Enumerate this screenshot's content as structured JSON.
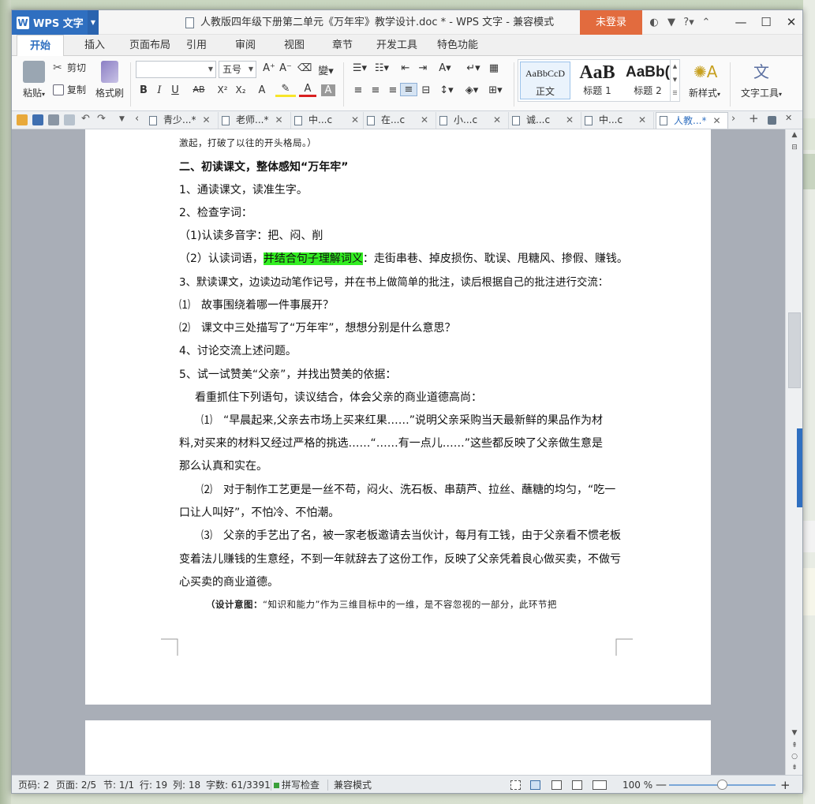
{
  "window": {
    "app_button": "WPS 文字",
    "title": "人教版四年级下册第二单元《万年牢》教学设计.doc * - WPS 文字 - 兼容模式",
    "login": "未登录",
    "title_icons": [
      "skin-icon",
      "shirt-icon",
      "help-icon",
      "ribbon-toggle-icon"
    ],
    "help": "?"
  },
  "ribbon_tabs": [
    "开始",
    "插入",
    "页面布局",
    "引用",
    "审阅",
    "视图",
    "章节",
    "开发工具",
    "特色功能"
  ],
  "ribbon": {
    "paste": "粘贴",
    "cut": "剪切",
    "copy": "复制",
    "format_painter": "格式刷",
    "font_name": "",
    "font_size": "五号",
    "grow_font": "A⁺",
    "shrink_font": "A⁻",
    "bold": "B",
    "italic": "I",
    "underline": "U",
    "strike": "AB",
    "superscript": "X²",
    "subscript": "X₂",
    "styles": [
      {
        "preview": "AaBbCcD",
        "name": "正文"
      },
      {
        "preview": "AaB",
        "name": "标题 1"
      },
      {
        "preview": "AaBb(",
        "name": "标题 2"
      }
    ],
    "new_style": "新样式",
    "text_tools": "文字工具"
  },
  "doc_tabs": [
    {
      "label": "青少...",
      "modified": "*"
    },
    {
      "label": "老师...",
      "modified": "*"
    },
    {
      "label": "中...c",
      "modified": ""
    },
    {
      "label": "在...c",
      "modified": ""
    },
    {
      "label": "小...c",
      "modified": ""
    },
    {
      "label": "诚...c",
      "modified": ""
    },
    {
      "label": "中...c",
      "modified": ""
    },
    {
      "label": "人教...",
      "modified": "*"
    }
  ],
  "document": {
    "lines": [
      {
        "text": "激起，打破了以往的开头格局。）",
        "style": "small"
      },
      {
        "text": "二、初读课文，整体感知“万年牢”",
        "style": "bold"
      },
      {
        "text": "1、通读课文，读准生字。",
        "style": "normal"
      },
      {
        "text": "2、检查字词：",
        "style": "normal"
      },
      {
        "text": "（1)认读多音字：把、闷、削",
        "style": "normal"
      },
      {
        "text_before": "（2）认读词语，",
        "highlight": "并结合句子理解词义",
        "text_after": "：走街串巷、掉皮损伤、耽误、甩糖风、掺假、赚钱。",
        "style": "highlight"
      },
      {
        "text": "3、默读课文，边读边动笔作记号，并在书上做简单的批注，读后根据自己的批注进行交流：",
        "style": "normal"
      },
      {
        "text": "⑴　故事围绕着哪一件事展开？",
        "style": "normal"
      },
      {
        "text": "⑵　课文中三处描写了“万年牢”，想想分别是什么意思？",
        "style": "normal"
      },
      {
        "text": "4、讨论交流上述问题。",
        "style": "normal"
      },
      {
        "text": "5、试一试赞美“父亲”，并找出赞美的依据：",
        "style": "normal"
      },
      {
        "text": "看重抓住下列语句，读议结合，体会父亲的商业道德高尚：",
        "style": "indent1"
      },
      {
        "text": "⑴　“早晨起来,父亲去市场上买来红果……”说明父亲采购当天最新鲜的果品作为材",
        "style": "indent2"
      },
      {
        "text": "料,对买来的材料又经过严格的挑选……“……有一点儿……”这些都反映了父亲做生意是",
        "style": "normal"
      },
      {
        "text": "那么认真和实在。",
        "style": "normal"
      },
      {
        "text": "⑵　对于制作工艺更是一丝不苟，闷火、洗石板、串葫芦、拉丝、蘸糖的均匀，“吃一",
        "style": "indent2"
      },
      {
        "text": "口让人叫好”，不怕冷、不怕潮。",
        "style": "normal"
      },
      {
        "text": "⑶　父亲的手艺出了名，被一家老板邀请去当伙计，每月有工钱，由于父亲看不惯老板",
        "style": "indent2"
      },
      {
        "text": "变着法儿赚钱的生意经，不到一年就辞去了这份工作，反映了父亲凭着良心做买卖，不做亏",
        "style": "normal"
      },
      {
        "text": "心买卖的商业道德。",
        "style": "normal"
      },
      {
        "text_bold": "（设计意图：",
        "text": "“知识和能力”作为三维目标中的一维，是不容忽视的一部分，此环节把",
        "style": "design"
      }
    ]
  },
  "status": {
    "page_num": "页码: 2",
    "pages": "页面: 2/5",
    "section": "节: 1/1",
    "row": "行: 19",
    "col": "列: 18",
    "words": "字数: 61/3391",
    "spell": "拼写检查",
    "compat": "兼容模式",
    "zoom": "100 %",
    "zoom_fraction": 0.5
  }
}
